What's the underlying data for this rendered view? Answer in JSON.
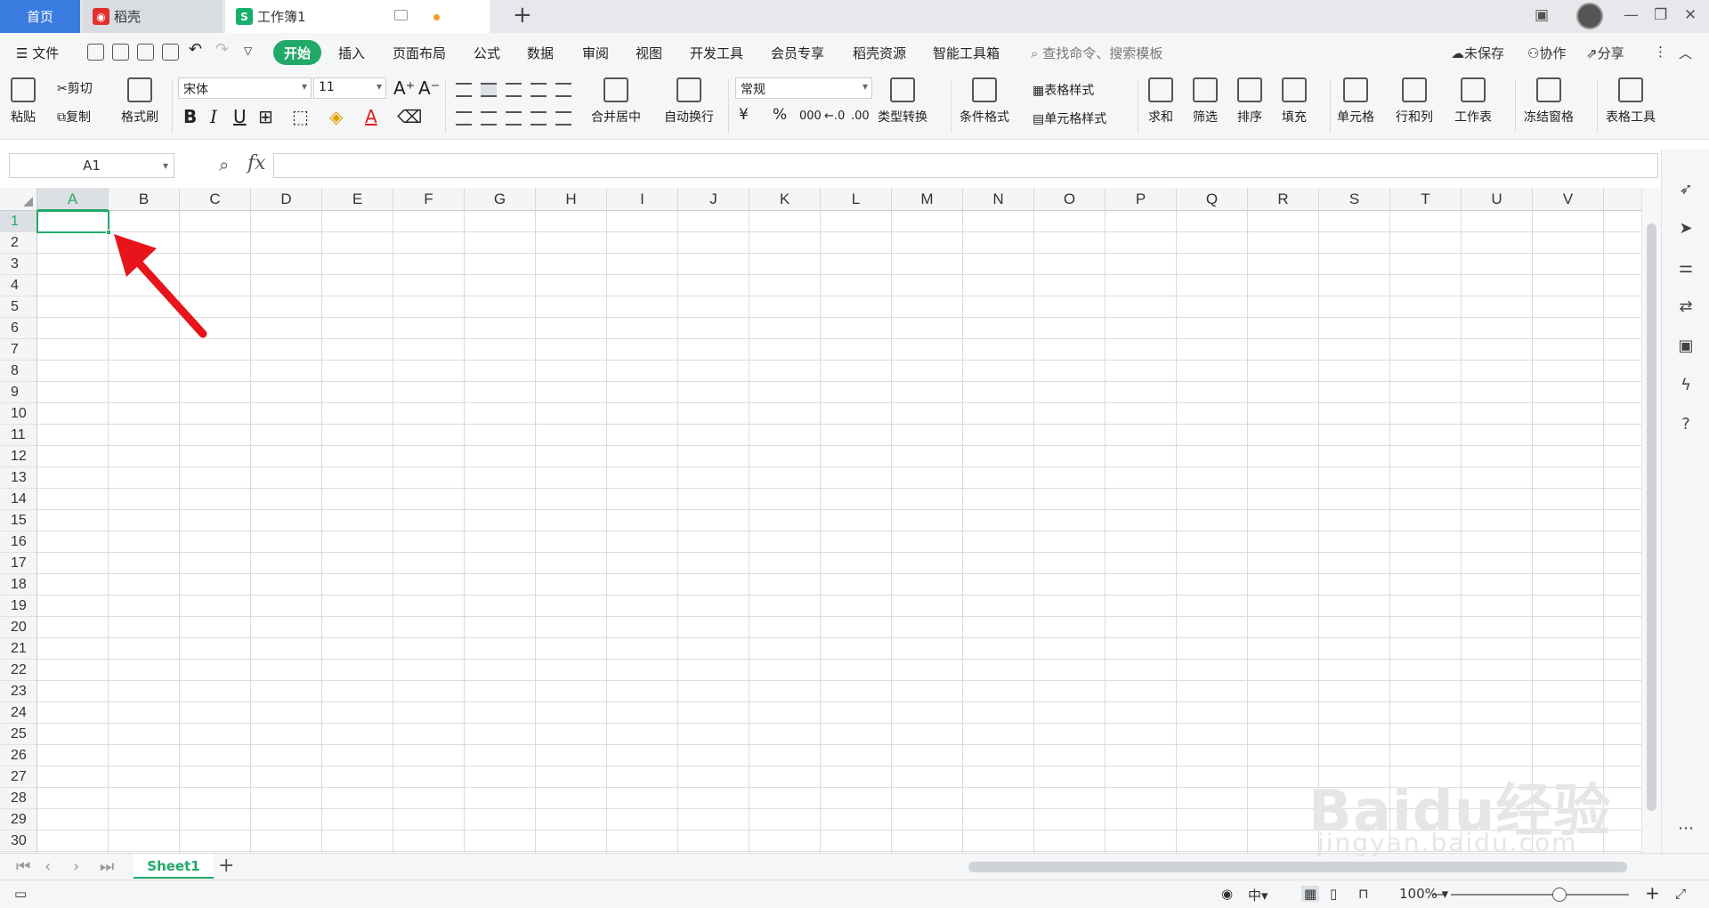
{
  "tabs": {
    "home": "首页",
    "daoke": "稻壳",
    "workbook": "工作簿1"
  },
  "menu": {
    "file": "文件",
    "items": [
      "开始",
      "插入",
      "页面布局",
      "公式",
      "数据",
      "审阅",
      "视图",
      "开发工具",
      "会员专享",
      "稻壳资源",
      "智能工具箱"
    ],
    "search": "查找命令、搜索模板",
    "unsaved": "未保存",
    "collab": "协作",
    "share": "分享"
  },
  "ribbon": {
    "paste": "粘贴",
    "cut": "剪切",
    "copy": "复制",
    "format_painter": "格式刷",
    "font_name": "宋体",
    "font_size": "11",
    "merge_center": "合并居中",
    "auto_wrap": "自动换行",
    "number_format": "常规",
    "type_convert": "类型转换",
    "cond_format": "条件格式",
    "table_style": "表格样式",
    "cell_style": "单元格样式",
    "sum": "求和",
    "filter": "筛选",
    "sort": "排序",
    "fill": "填充",
    "cell": "单元格",
    "row_col": "行和列",
    "worksheet": "工作表",
    "freeze": "冻结窗格",
    "table_tools": "表格工具",
    "bold": "B",
    "italic": "I",
    "underline": "U",
    "currency": "¥",
    "percent": "%",
    "thousands": "000"
  },
  "formula_bar": {
    "name_box": "A1",
    "fx": "fx"
  },
  "grid": {
    "columns": [
      "A",
      "B",
      "C",
      "D",
      "E",
      "F",
      "G",
      "H",
      "I",
      "J",
      "K",
      "L",
      "M",
      "N",
      "O",
      "P",
      "Q",
      "R",
      "S",
      "T",
      "U",
      "V"
    ],
    "rows": [
      "1",
      "2",
      "3",
      "4",
      "5",
      "6",
      "7",
      "8",
      "9",
      "10",
      "11",
      "12",
      "13",
      "14",
      "15",
      "16",
      "17",
      "18",
      "19",
      "20",
      "21",
      "22",
      "23",
      "24",
      "25",
      "26",
      "27",
      "28",
      "29",
      "30"
    ],
    "active_col": "A",
    "active_row": "1"
  },
  "sheets": {
    "active": "Sheet1"
  },
  "status": {
    "zoom": "100%"
  },
  "watermark": {
    "brand": "Baidu经验",
    "url": "jingyan.baidu.com"
  },
  "colors": {
    "accent": "#21a969",
    "tab_home": "#3a7be0",
    "arrow": "#e8141b"
  }
}
